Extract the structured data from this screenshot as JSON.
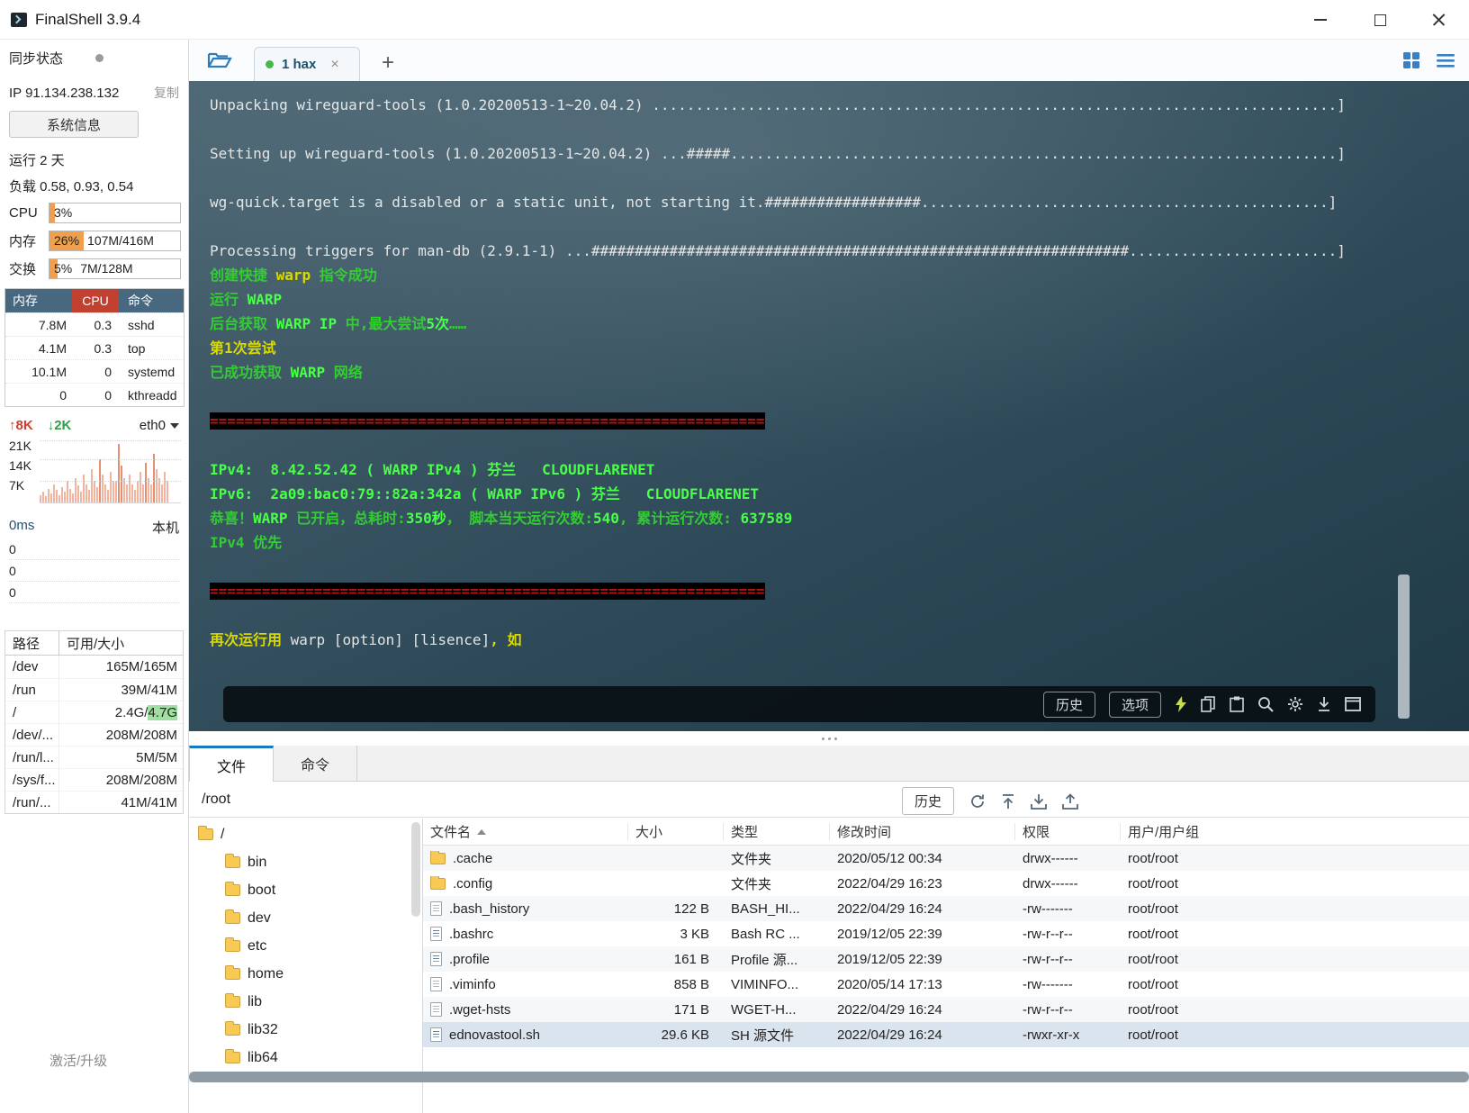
{
  "titlebar": {
    "title": "FinalShell 3.9.4"
  },
  "sidebar": {
    "sync_status": "同步状态",
    "ip": "IP 91.134.238.132",
    "copy": "复制",
    "sysinfo": "系统信息",
    "uptime": "运行 2 天",
    "load": "负载 0.58, 0.93, 0.54",
    "cpu": {
      "label": "CPU",
      "pct_text": "3%"
    },
    "mem": {
      "label": "内存",
      "pct_text": "26%",
      "detail": "107M/416M"
    },
    "swap": {
      "label": "交换",
      "pct_text": "5%",
      "detail": "7M/128M"
    },
    "proc": {
      "headers": [
        "内存",
        "CPU",
        "命令"
      ],
      "rows": [
        [
          "7.8M",
          "0.3",
          "sshd"
        ],
        [
          "4.1M",
          "0.3",
          "top"
        ],
        [
          "10.1M",
          "0",
          "systemd"
        ],
        [
          "0",
          "0",
          "kthreadd"
        ]
      ]
    },
    "net": {
      "up_icon": "↑",
      "up": "8K",
      "down_icon": "↓",
      "down": "2K",
      "iface": "eth0",
      "scale": [
        "21K",
        "14K",
        "7K"
      ],
      "bars": [
        0.12,
        0.18,
        0.1,
        0.22,
        0.15,
        0.3,
        0.2,
        0.12,
        0.25,
        0.18,
        0.35,
        0.22,
        0.15,
        0.4,
        0.28,
        0.18,
        0.45,
        0.3,
        0.2,
        0.55,
        0.35,
        0.25,
        0.7,
        0.45,
        0.3,
        0.2,
        0.5,
        0.35,
        0.35,
        0.95,
        0.6,
        0.4,
        0.3,
        0.45,
        0.3,
        0.2,
        0.35,
        0.5,
        0.3,
        0.65,
        0.4,
        0.3,
        0.8,
        0.55,
        0.4,
        0.3,
        0.5,
        0.35
      ]
    },
    "ping": {
      "latency": "0ms",
      "host": "本机",
      "values": [
        "0",
        "0",
        "0"
      ]
    },
    "disk": {
      "headers": [
        "路径",
        "可用/大小"
      ],
      "rows": [
        {
          "path": "/dev",
          "value": "165M/165M"
        },
        {
          "path": "/run",
          "value": "39M/41M"
        },
        {
          "path": "/",
          "value": "2.4G/",
          "hl": "4.7G"
        },
        {
          "path": "/dev/...",
          "value": "208M/208M"
        },
        {
          "path": "/run/l...",
          "value": "5M/5M"
        },
        {
          "path": "/sys/f...",
          "value": "208M/208M"
        },
        {
          "path": "/run/...",
          "value": "41M/41M"
        }
      ]
    },
    "activate": "激活/升级"
  },
  "tabbar": {
    "tab": "1 hax",
    "close": "×",
    "add": "+"
  },
  "terminal": {
    "toolbar": {
      "history": "历史",
      "options": "选项"
    },
    "lines": [
      [
        {
          "t": "Unpacking wireguard-tools (1.0.20200513-1~20.04.2) ...............................................................................]",
          "c": "w"
        }
      ],
      [],
      [
        {
          "t": "Setting up wireguard-tools (1.0.20200513-1~20.04.2) ...#####......................................................................]",
          "c": "w"
        }
      ],
      [],
      [
        {
          "t": "wg-quick.target is a disabled or a static unit, not starting it.##################...............................................]",
          "c": "w"
        }
      ],
      [],
      [
        {
          "t": "Processing triggers for man-db (2.9.1-1) ...##############################################################........................]",
          "c": "w"
        }
      ],
      [
        {
          "t": "创建快捷 ",
          "c": "g"
        },
        {
          "t": "warp",
          "c": "y"
        },
        {
          "t": " 指令成功",
          "c": "g"
        }
      ],
      [
        {
          "t": "运行 ",
          "c": "g"
        },
        {
          "t": "WARP",
          "c": "gb"
        }
      ],
      [
        {
          "t": "后台获取 ",
          "c": "g"
        },
        {
          "t": "WARP IP",
          "c": "gb"
        },
        {
          "t": " 中,最大尝试",
          "c": "g"
        },
        {
          "t": "5次",
          "c": "gb"
        },
        {
          "t": "……",
          "c": "g"
        }
      ],
      [
        {
          "t": "第1次尝试",
          "c": "y"
        }
      ],
      [
        {
          "t": "已成功获取 ",
          "c": "g"
        },
        {
          "t": "WARP",
          "c": "gb"
        },
        {
          "t": " 网络",
          "c": "g"
        }
      ],
      [],
      [
        {
          "t": "================================================================",
          "c": "sep"
        }
      ],
      [],
      [
        {
          "t": "IPv4:  8.42.52.42 ( WARP IPv4 ) 芬兰   CLOUDFLARENET",
          "c": "gb"
        }
      ],
      [
        {
          "t": "IPv6:  2a09:bac0:79::82a:342a ( WARP IPv6 ) 芬兰   CLOUDFLARENET",
          "c": "gb"
        }
      ],
      [
        {
          "t": "恭喜！",
          "c": "g"
        },
        {
          "t": "WARP",
          "c": "gb"
        },
        {
          "t": " 已开启，总耗时:",
          "c": "g"
        },
        {
          "t": "350秒",
          "c": "gb"
        },
        {
          "t": "， 脚本当天运行次数:",
          "c": "g"
        },
        {
          "t": "540",
          "c": "gb"
        },
        {
          "t": ", 累计运行次数: ",
          "c": "g"
        },
        {
          "t": "637589",
          "c": "gb"
        }
      ],
      [
        {
          "t": "IPv4 优先",
          "c": "g"
        }
      ],
      [],
      [
        {
          "t": "================================================================",
          "c": "sep"
        }
      ],
      [],
      [
        {
          "t": "再次运行用 ",
          "c": "y"
        },
        {
          "t": "warp [option] [lisence]",
          "c": "w"
        },
        {
          "t": ", 如",
          "c": "y"
        }
      ]
    ]
  },
  "bottom": {
    "tabs": {
      "files": "文件",
      "commands": "命令"
    },
    "path": "/root",
    "history": "历史",
    "tree": [
      {
        "label": "/",
        "level": 0
      },
      {
        "label": "bin",
        "level": 1
      },
      {
        "label": "boot",
        "level": 1
      },
      {
        "label": "dev",
        "level": 1
      },
      {
        "label": "etc",
        "level": 1
      },
      {
        "label": "home",
        "level": 1
      },
      {
        "label": "lib",
        "level": 1
      },
      {
        "label": "lib32",
        "level": 1
      },
      {
        "label": "lib64",
        "level": 1
      }
    ],
    "table": {
      "headers": [
        "文件名",
        "大小",
        "类型",
        "修改时间",
        "权限",
        "用户/用户组"
      ],
      "rows": [
        {
          "icon": "folder",
          "name": ".cache",
          "size": "",
          "type": "文件夹",
          "mtime": "2020/05/12 00:34",
          "perm": "drwx------",
          "owner": "root/root"
        },
        {
          "icon": "folder",
          "name": ".config",
          "size": "",
          "type": "文件夹",
          "mtime": "2022/04/29 16:23",
          "perm": "drwx------",
          "owner": "root/root"
        },
        {
          "icon": "file",
          "name": ".bash_history",
          "size": "122 B",
          "type": "BASH_HI...",
          "mtime": "2022/04/29 16:24",
          "perm": "-rw-------",
          "owner": "root/root"
        },
        {
          "icon": "filecode",
          "name": ".bashrc",
          "size": "3 KB",
          "type": "Bash RC ...",
          "mtime": "2019/12/05 22:39",
          "perm": "-rw-r--r--",
          "owner": "root/root"
        },
        {
          "icon": "filecode",
          "name": ".profile",
          "size": "161 B",
          "type": "Profile 源...",
          "mtime": "2019/12/05 22:39",
          "perm": "-rw-r--r--",
          "owner": "root/root"
        },
        {
          "icon": "file",
          "name": ".viminfo",
          "size": "858 B",
          "type": "VIMINFO...",
          "mtime": "2020/05/14 17:13",
          "perm": "-rw-------",
          "owner": "root/root"
        },
        {
          "icon": "file",
          "name": ".wget-hsts",
          "size": "171 B",
          "type": "WGET-H...",
          "mtime": "2022/04/29 16:24",
          "perm": "-rw-r--r--",
          "owner": "root/root"
        },
        {
          "icon": "filecode",
          "name": "ednovastool.sh",
          "size": "29.6 KB",
          "type": "SH 源文件",
          "mtime": "2022/04/29 16:24",
          "perm": "-rwxr-xr-x",
          "owner": "root/root",
          "selected": true
        }
      ]
    }
  }
}
